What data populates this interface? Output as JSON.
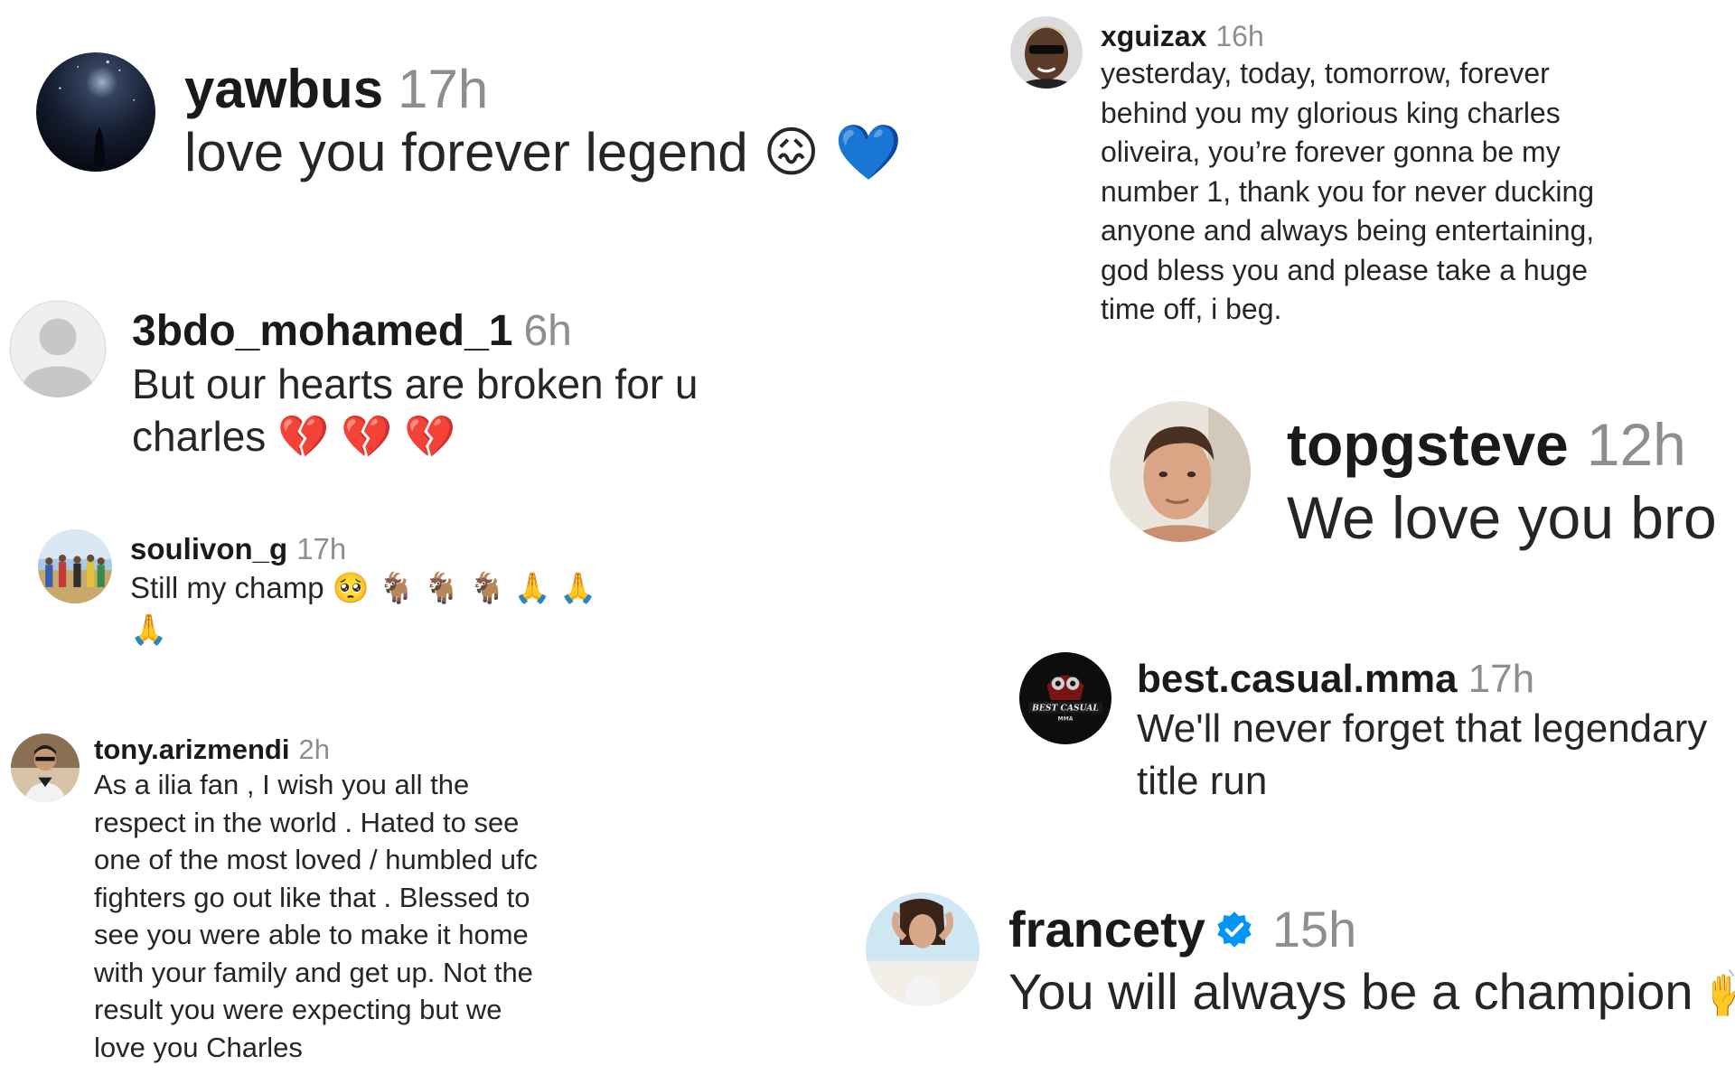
{
  "comments": [
    {
      "username": "yawbus",
      "time": "17h",
      "text": "love you forever legend 😖 💙"
    },
    {
      "username": "3bdo_mohamed_1",
      "time": "6h",
      "text": "But our hearts are broken for u charles 💔 💔 💔"
    },
    {
      "username": "soulivon_g",
      "time": "17h",
      "text": "Still my champ 🥺 🐐 🐐 🐐 🙏 🙏 🙏"
    },
    {
      "username": "tony.arizmendi",
      "time": "2h",
      "text": "As a ilia fan , I wish you all the respect in the world . Hated to see one of the most loved / humbled ufc fighters go out like that . Blessed to see you were able to make it home with your family and get up. Not the result you were expecting but we love you Charles"
    },
    {
      "username": "xguizax",
      "time": "16h",
      "text": "yesterday, today, tomorrow, forever behind you my glorious king charles oliveira, you’re forever gonna be my number 1, thank you for never ducking anyone and always being entertaining, god bless you and please take a huge time off, i beg."
    },
    {
      "username": "topgsteve",
      "time": "12h",
      "text": "We love you bro"
    },
    {
      "username": "best.casual.mma",
      "time": "17h",
      "text": "We'll never forget that legendary title run",
      "avatar_text": "BEST CASUAL MMA"
    },
    {
      "username": "francety",
      "time": "15h",
      "text": "You will always be a champion 🙌",
      "verified": true
    }
  ],
  "colors": {
    "username": "#1a1a1a",
    "timestamp": "#8e8e8e",
    "verified_badge": "#0095f6"
  }
}
